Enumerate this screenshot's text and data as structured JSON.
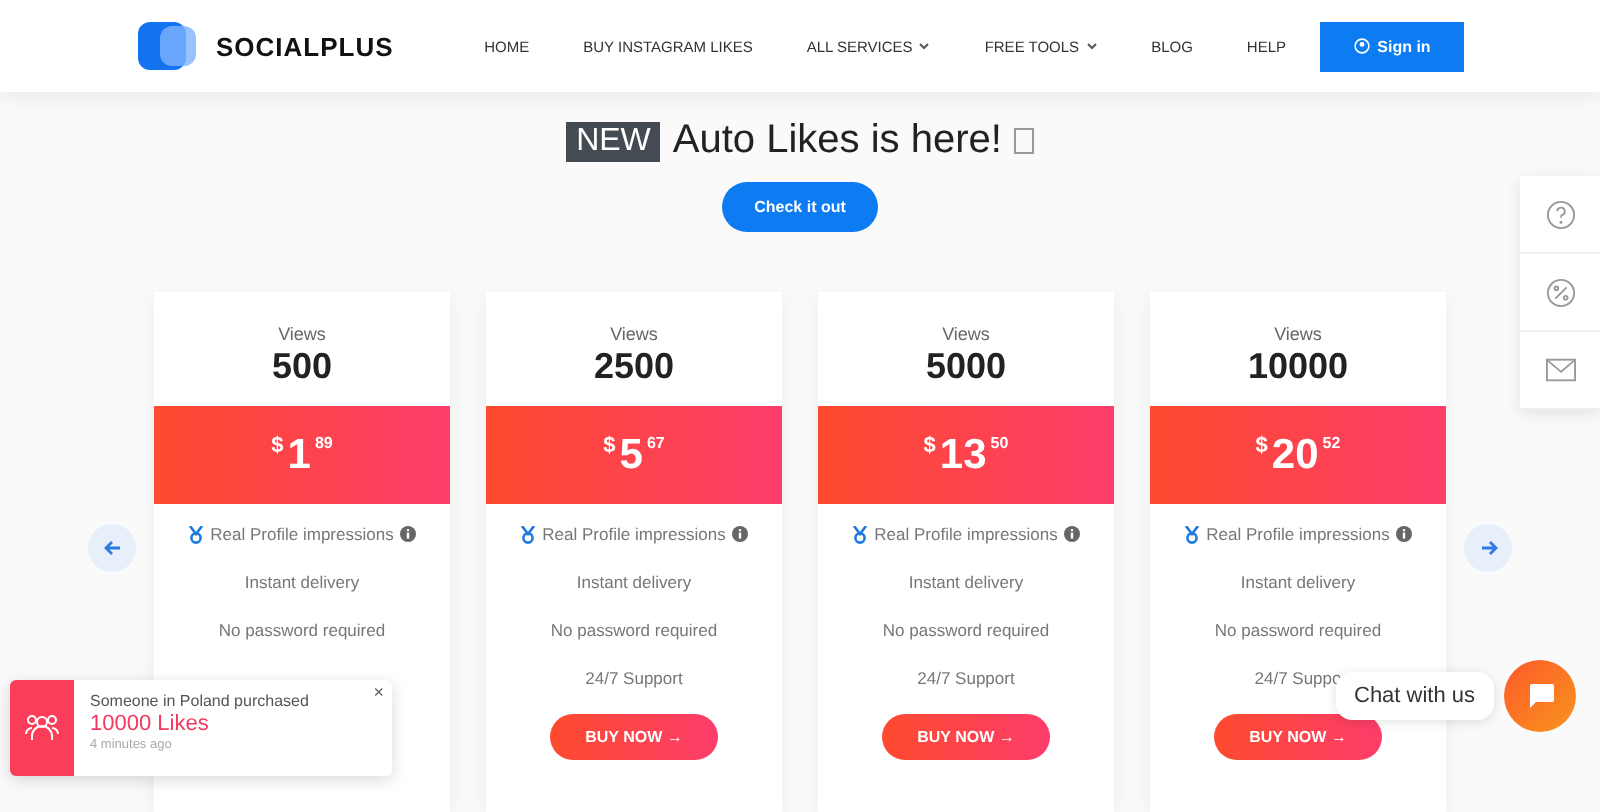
{
  "header": {
    "logo": "SOCIALPLUS",
    "nav": [
      {
        "label": "HOME",
        "dropdown": false
      },
      {
        "label": "BUY INSTAGRAM LIKES",
        "dropdown": false
      },
      {
        "label": "ALL SERVICES",
        "dropdown": true
      },
      {
        "label": "FREE TOOLS",
        "dropdown": true
      },
      {
        "label": "BLOG",
        "dropdown": false
      },
      {
        "label": "HELP",
        "dropdown": false
      }
    ],
    "sign_in": "Sign in"
  },
  "banner": {
    "badge": "NEW",
    "headline": "Auto Likes is here!",
    "button": "Check it out"
  },
  "cards": [
    {
      "label": "Views",
      "amount": "500",
      "currency": "$",
      "price": "1",
      "cents": "89",
      "features": [
        "Real Profile impressions",
        "Instant delivery",
        "No password required"
      ]
    },
    {
      "label": "Views",
      "amount": "2500",
      "currency": "$",
      "price": "5",
      "cents": "67",
      "features": [
        "Real Profile impressions",
        "Instant delivery",
        "No password required",
        "24/7 Support"
      ],
      "button": "BUY NOW →"
    },
    {
      "label": "Views",
      "amount": "5000",
      "currency": "$",
      "price": "13",
      "cents": "50",
      "features": [
        "Real Profile impressions",
        "Instant delivery",
        "No password required",
        "24/7 Support"
      ],
      "button": "BUY NOW →"
    },
    {
      "label": "Views",
      "amount": "10000",
      "currency": "$",
      "price": "20",
      "cents": "52",
      "features": [
        "Real Profile impressions",
        "Instant delivery",
        "No password required",
        "24/7 Suppo"
      ],
      "button": "BUY NOW →"
    }
  ],
  "toast": {
    "message": "Someone in Poland purchased",
    "product": "10000 Likes",
    "time": "4 minutes ago",
    "close": "×"
  },
  "chat": {
    "label": "Chat with us"
  }
}
